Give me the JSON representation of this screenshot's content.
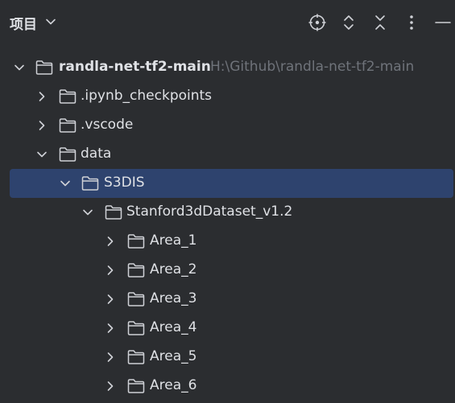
{
  "header": {
    "title": "项目",
    "icons": [
      "crosshair-icon",
      "expand-all-icon",
      "collapse-all-icon",
      "more-icon",
      "minimize-icon"
    ]
  },
  "tree": {
    "root": {
      "label": "randla-net-tf2-main",
      "path": "H:\\Github\\randla-net-tf2-main",
      "expanded": true
    },
    "items": [
      {
        "label": ".ipynb_checkpoints",
        "expanded": false
      },
      {
        "label": ".vscode",
        "expanded": false
      },
      {
        "label": "data",
        "expanded": true
      },
      {
        "label": "S3DIS",
        "expanded": true,
        "selected": true
      },
      {
        "label": "Stanford3dDataset_v1.2",
        "expanded": true
      },
      {
        "label": "Area_1",
        "expanded": false
      },
      {
        "label": "Area_2",
        "expanded": false
      },
      {
        "label": "Area_3",
        "expanded": false
      },
      {
        "label": "Area_4",
        "expanded": false
      },
      {
        "label": "Area_5",
        "expanded": false
      },
      {
        "label": "Area_6",
        "expanded": false
      }
    ]
  }
}
